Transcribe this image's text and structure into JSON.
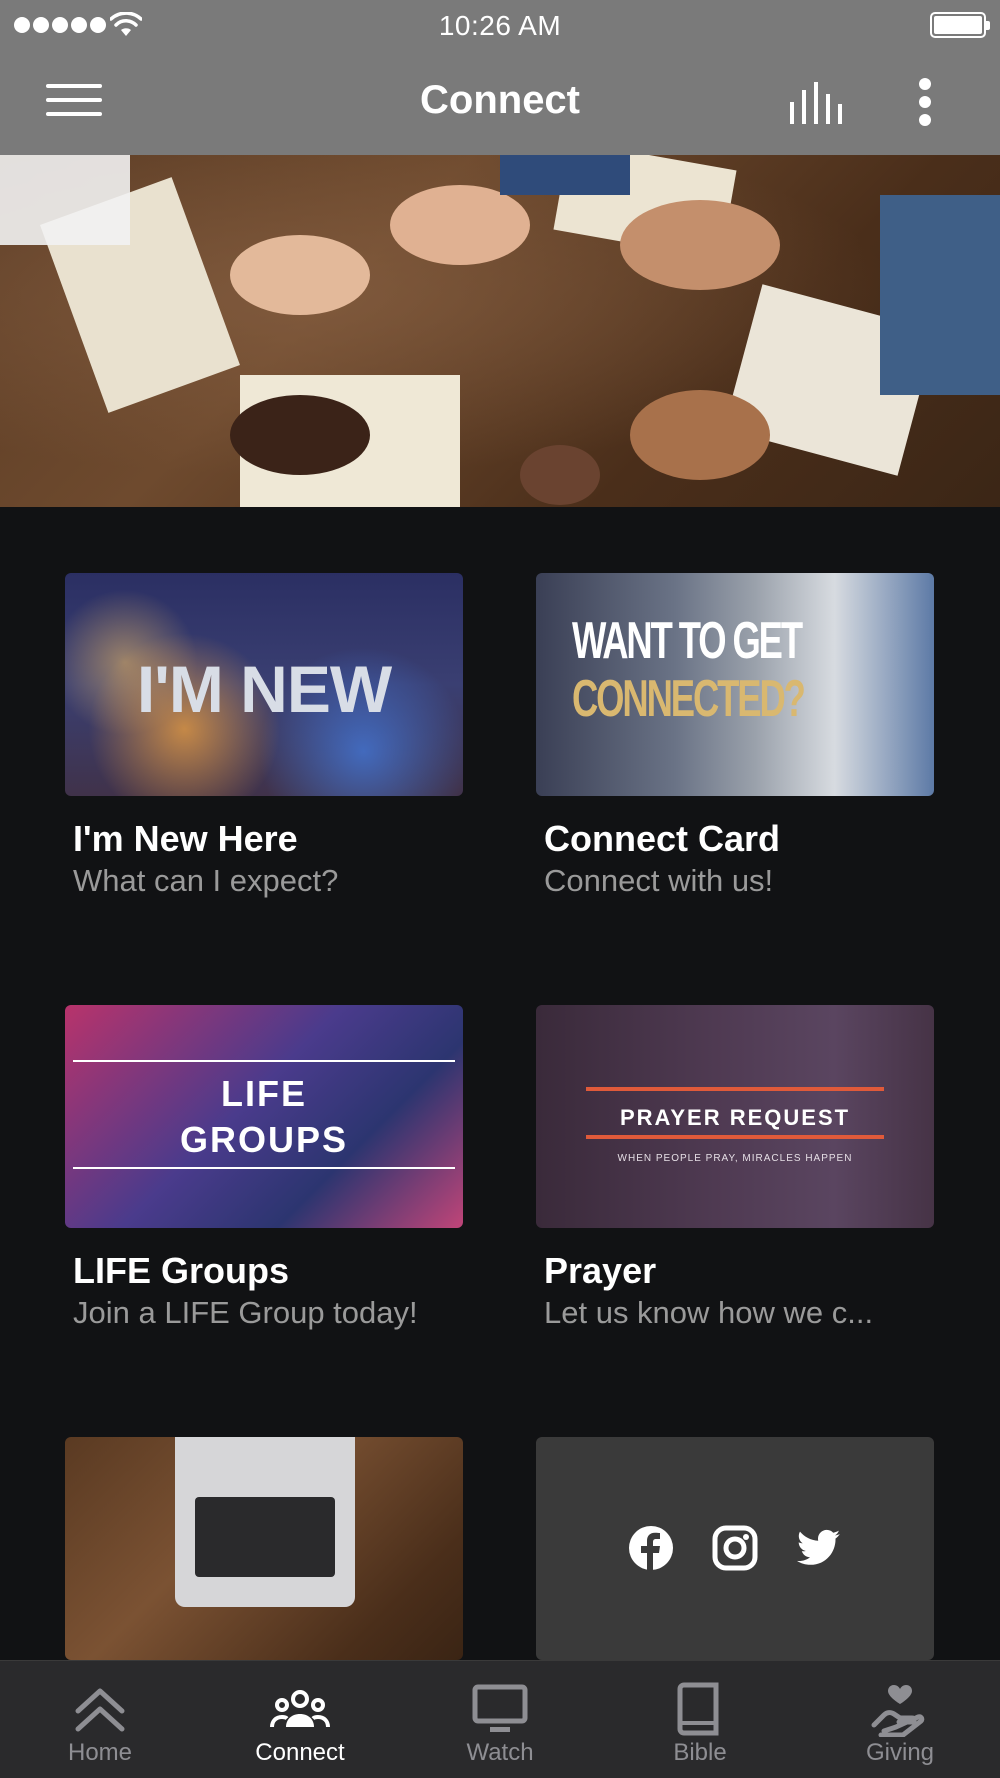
{
  "status_bar": {
    "time": "10:26 AM"
  },
  "nav": {
    "title": "Connect"
  },
  "tiles": [
    {
      "title": "I'm New Here",
      "subtitle": "What can I expect?",
      "image_text": "I'M NEW"
    },
    {
      "title": "Connect Card",
      "subtitle": "Connect with us!",
      "image_text_1": "WANT TO GET",
      "image_text_2": "CONNECTED?"
    },
    {
      "title": "LIFE Groups",
      "subtitle": "Join a LIFE Group today!",
      "image_text_1": "LIFE",
      "image_text_2": "GROUPS"
    },
    {
      "title": "Prayer",
      "subtitle": "Let us know how we c...",
      "image_text_1": "PRAYER REQUEST",
      "image_text_2": "WHEN PEOPLE PRAY, MIRACLES HAPPEN"
    }
  ],
  "social": {
    "icons": [
      "facebook-icon",
      "instagram-icon",
      "twitter-icon"
    ]
  },
  "tab_bar": {
    "tabs": [
      {
        "label": "Home",
        "icon": "chevron-up-double-icon",
        "active": false
      },
      {
        "label": "Connect",
        "icon": "people-icon",
        "active": true
      },
      {
        "label": "Watch",
        "icon": "tv-icon",
        "active": false
      },
      {
        "label": "Bible",
        "icon": "book-icon",
        "active": false
      },
      {
        "label": "Giving",
        "icon": "hand-heart-icon",
        "active": false
      }
    ]
  },
  "colors": {
    "header_bg": "#7a7a7a",
    "page_bg": "#111214",
    "tab_bar_bg": "#2a2a2c",
    "accent_red": "#e05a3a"
  }
}
